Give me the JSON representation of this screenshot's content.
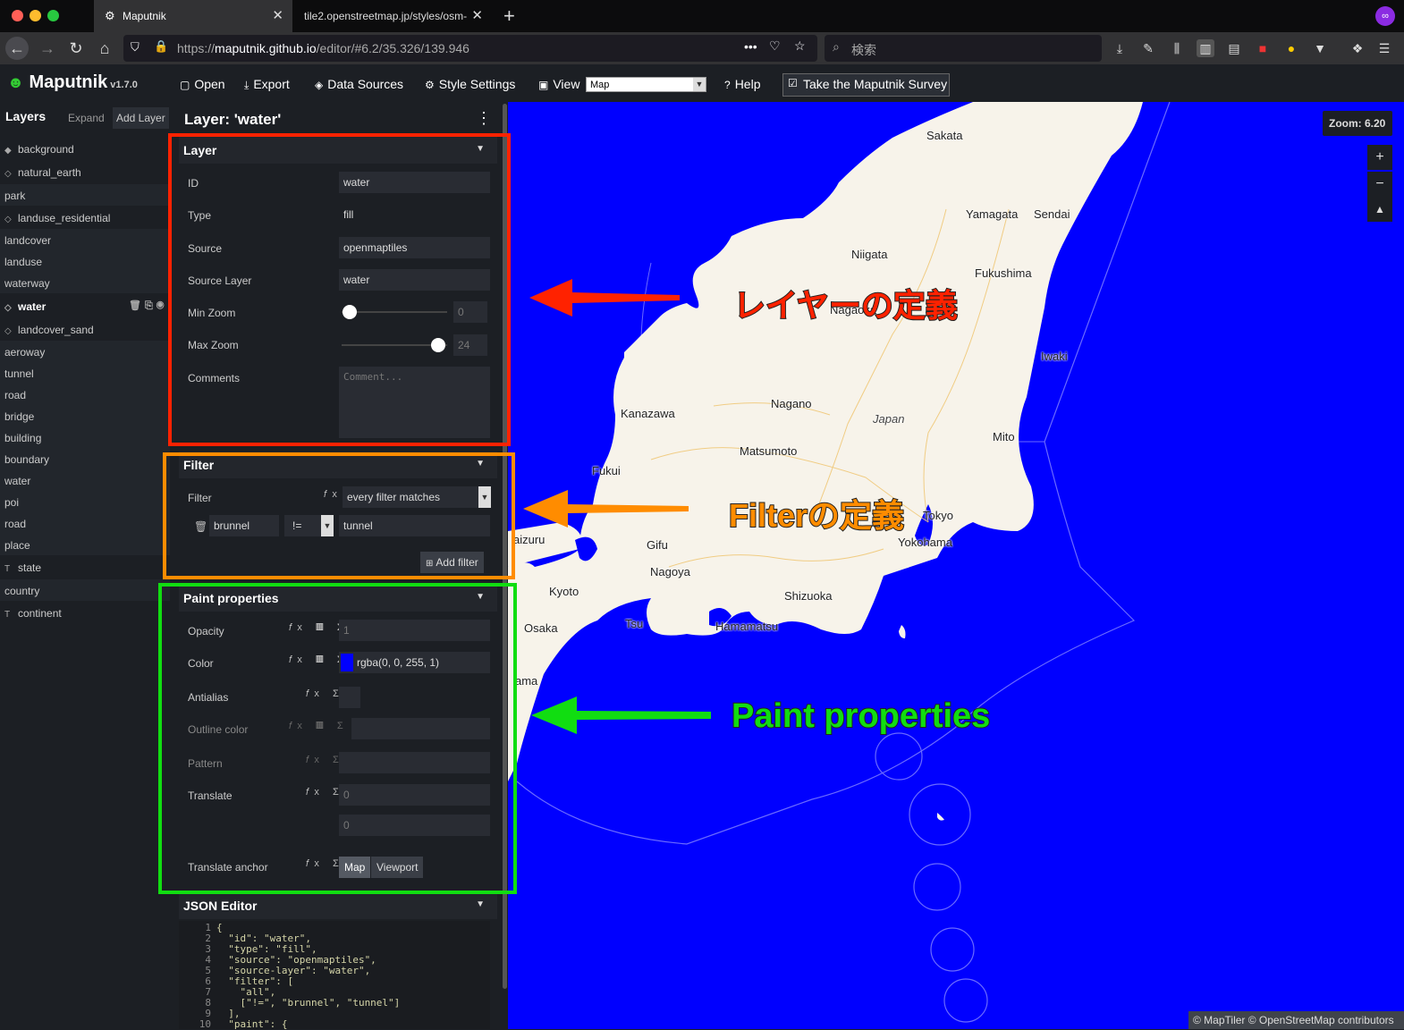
{
  "browser": {
    "tabs": [
      {
        "label": "Maputnik",
        "close": "✕"
      },
      {
        "label": "tile2.openstreetmap.jp/styles/osm-",
        "close": "✕"
      }
    ],
    "new_tab": "+",
    "url_prefix": "https://",
    "url_host": "maputnik.github.io",
    "url_path": "/editor/#6.2/35.326/139.946",
    "search_placeholder": "検索"
  },
  "app": {
    "name": "Maputnik",
    "version": "v1.7.0",
    "menu": {
      "open": "Open",
      "export": "Export",
      "data_sources": "Data Sources",
      "style_settings": "Style Settings",
      "view": "View",
      "view_value": "Map",
      "help": "Help",
      "survey": "Take the Maputnik Survey"
    }
  },
  "layers_panel": {
    "title": "Layers",
    "expand": "Expand",
    "add_layer": "Add Layer",
    "items": [
      {
        "label": "background",
        "icon": "◆",
        "group": false
      },
      {
        "label": "natural_earth",
        "icon": "◇",
        "group": false
      },
      {
        "label": "park",
        "icon": "",
        "group": true
      },
      {
        "label": "landuse_residential",
        "icon": "◇",
        "group": false
      },
      {
        "label": "landcover",
        "icon": "",
        "group": true
      },
      {
        "label": "landuse",
        "icon": "",
        "group": true
      },
      {
        "label": "waterway",
        "icon": "",
        "group": true
      },
      {
        "label": "water",
        "icon": "◇",
        "group": false,
        "selected": true
      },
      {
        "label": "landcover_sand",
        "icon": "◇",
        "group": false
      },
      {
        "label": "aeroway",
        "icon": "",
        "group": true
      },
      {
        "label": "tunnel",
        "icon": "",
        "group": true
      },
      {
        "label": "road",
        "icon": "",
        "group": true
      },
      {
        "label": "bridge",
        "icon": "",
        "group": true
      },
      {
        "label": "building",
        "icon": "",
        "group": true
      },
      {
        "label": "boundary",
        "icon": "",
        "group": true
      },
      {
        "label": "water",
        "icon": "",
        "group": true
      },
      {
        "label": "poi",
        "icon": "",
        "group": true
      },
      {
        "label": "road",
        "icon": "",
        "group": true
      },
      {
        "label": "place",
        "icon": "",
        "group": true
      },
      {
        "label": "state",
        "icon": "T",
        "group": false
      },
      {
        "label": "country",
        "icon": "",
        "group": true
      },
      {
        "label": "continent",
        "icon": "T",
        "group": false
      }
    ]
  },
  "editor": {
    "title": "Layer: 'water'",
    "layer_section": {
      "header": "Layer",
      "id_label": "ID",
      "id_value": "water",
      "type_label": "Type",
      "type_value": "fill",
      "source_label": "Source",
      "source_value": "openmaptiles",
      "source_layer_label": "Source Layer",
      "source_layer_value": "water",
      "min_zoom_label": "Min Zoom",
      "min_zoom_value": "0",
      "min_zoom_level": 0,
      "max_zoom_label": "Max Zoom",
      "max_zoom_value": "24",
      "max_zoom_level": 24,
      "comments_label": "Comments",
      "comments_placeholder": "Comment..."
    },
    "filter_section": {
      "header": "Filter",
      "filter_label": "Filter",
      "filter_mode": "every filter matches",
      "field": "brunnel",
      "operator": "!=",
      "value": "tunnel",
      "add_filter": "Add filter"
    },
    "paint_section": {
      "header": "Paint properties",
      "opacity_label": "Opacity",
      "opacity_value": "1",
      "color_label": "Color",
      "color_value": "rgba(0, 0, 255, 1)",
      "antialias_label": "Antialias",
      "outline_color_label": "Outline color",
      "pattern_label": "Pattern",
      "translate_label": "Translate",
      "translate_x": "0",
      "translate_y": "0",
      "translate_anchor_label": "Translate anchor",
      "anchor_map": "Map",
      "anchor_viewport": "Viewport"
    },
    "json_section": {
      "header": "JSON Editor",
      "lines": [
        {
          "n": "1",
          "code": "{"
        },
        {
          "n": "2",
          "code": "  \"id\": \"water\","
        },
        {
          "n": "3",
          "code": "  \"type\": \"fill\","
        },
        {
          "n": "4",
          "code": "  \"source\": \"openmaptiles\","
        },
        {
          "n": "5",
          "code": "  \"source-layer\": \"water\","
        },
        {
          "n": "6",
          "code": "  \"filter\": ["
        },
        {
          "n": "7",
          "code": "    \"all\","
        },
        {
          "n": "8",
          "code": "    [\"!=\", \"brunnel\", \"tunnel\"]"
        },
        {
          "n": "9",
          "code": "  ],"
        },
        {
          "n": "10",
          "code": "  \"paint\": {"
        }
      ]
    }
  },
  "map": {
    "zoom_label": "Zoom: 6.20",
    "zoom_in": "+",
    "zoom_out": "−",
    "compass": "▲",
    "attribution": "© MapTiler © OpenStreetMap contributors",
    "water_color": "#0000ff",
    "land_color": "#f7f3ea",
    "labels": [
      {
        "text": "Sakata"
      },
      {
        "text": "Yamagata"
      },
      {
        "text": "Sendai"
      },
      {
        "text": "Niigata"
      },
      {
        "text": "Fukushima"
      },
      {
        "text": "Nagaoka"
      },
      {
        "text": "Iwaki"
      },
      {
        "text": "Nagano"
      },
      {
        "text": "Japan"
      },
      {
        "text": "Kanazawa"
      },
      {
        "text": "Mito"
      },
      {
        "text": "Matsumoto"
      },
      {
        "text": "Fukui"
      },
      {
        "text": "Tokyo"
      },
      {
        "text": "Yokohama"
      },
      {
        "text": "Gifu"
      },
      {
        "text": "aizuru"
      },
      {
        "text": "Nagoya"
      },
      {
        "text": "Kyoto"
      },
      {
        "text": "Shizuoka"
      },
      {
        "text": "Osaka"
      },
      {
        "text": "Tsu"
      },
      {
        "text": "Hamamatsu"
      },
      {
        "text": "ama"
      }
    ]
  },
  "annotations": {
    "layer_def": "レイヤーの定義",
    "filter_def": "Filterの定義",
    "paint_def": "Paint properties",
    "colors": {
      "red": "#ff2200",
      "orange": "#ff8c00",
      "green": "#11dd11"
    }
  }
}
